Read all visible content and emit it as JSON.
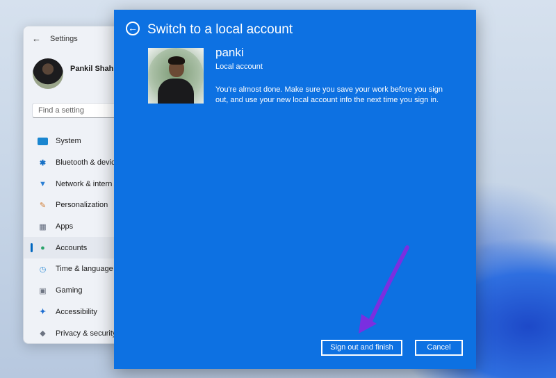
{
  "settings": {
    "title": "Settings",
    "user_name": "Pankil Shah",
    "search_placeholder": "Find a setting",
    "nav": [
      {
        "label": "System",
        "icon": "system-icon"
      },
      {
        "label": "Bluetooth & devic",
        "icon": "bluetooth-icon"
      },
      {
        "label": "Network & intern",
        "icon": "wifi-icon"
      },
      {
        "label": "Personalization",
        "icon": "brush-icon"
      },
      {
        "label": "Apps",
        "icon": "apps-icon"
      },
      {
        "label": "Accounts",
        "icon": "accounts-icon",
        "active": true
      },
      {
        "label": "Time & language",
        "icon": "globe-clock-icon"
      },
      {
        "label": "Gaming",
        "icon": "gamepad-icon"
      },
      {
        "label": "Accessibility",
        "icon": "accessibility-icon"
      },
      {
        "label": "Privacy & security",
        "icon": "shield-icon"
      }
    ]
  },
  "dialog": {
    "title": "Switch to a local account",
    "account_name": "panki",
    "account_type": "Local account",
    "message": "You're almost done. Make sure you save your work before you sign out, and use your new local account info the next time you sign in.",
    "sign_out_button": "Sign out and finish",
    "cancel_button": "Cancel",
    "accent_color": "#0d71e2"
  },
  "annotation": {
    "arrow_color": "#7a2fe0",
    "points_to": "sign-out-and-finish-button"
  }
}
